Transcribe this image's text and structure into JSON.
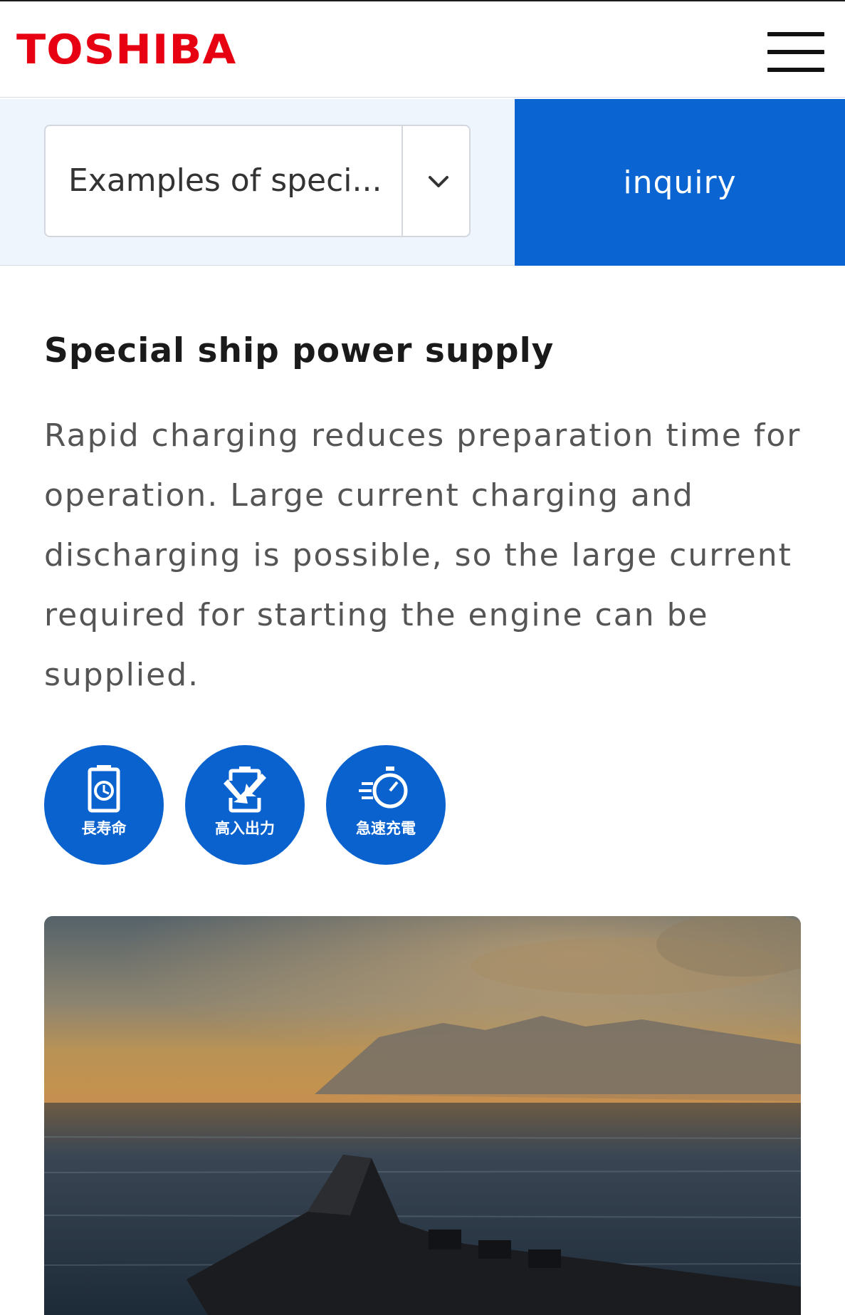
{
  "header": {
    "logo_text": "TOSHIBA",
    "menu_icon": "hamburger-menu-icon",
    "brand_color": "#e60012"
  },
  "subnav": {
    "select_value": "Examples of speci...",
    "select_icon": "chevron-down-icon",
    "inquiry_label": "inquiry",
    "accent_color": "#0a64d2"
  },
  "main": {
    "title": "Special ship power supply",
    "description": "Rapid charging reduces preparation time for operation. Large current charging and discharging is possible, so the large current required for starting the engine can be supplied.",
    "badges": [
      {
        "label": "長寿命",
        "icon": "battery-clock-icon"
      },
      {
        "label": "高入出力",
        "icon": "battery-arrows-icon"
      },
      {
        "label": "急速充電",
        "icon": "stopwatch-icon"
      }
    ],
    "image": {
      "subject": "ship-at-sea-photo"
    }
  }
}
